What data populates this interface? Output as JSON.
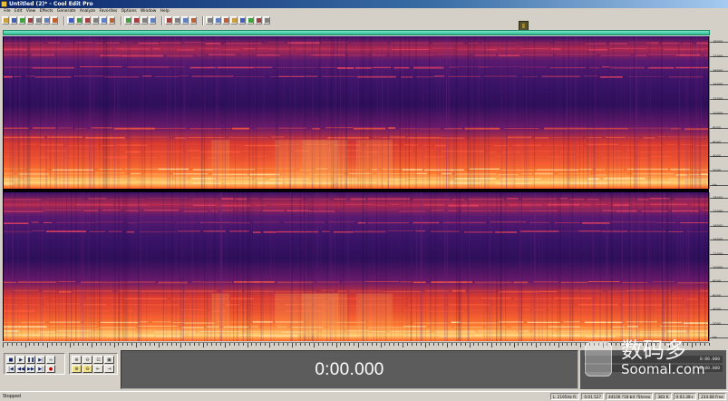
{
  "window": {
    "title": "Untitled (2)* - Cool Edit Pro"
  },
  "menu": [
    "File",
    "Edit",
    "View",
    "Effects",
    "Generate",
    "Analyze",
    "Favorites",
    "Options",
    "Window",
    "Help"
  ],
  "toolbar": {
    "groups": [
      [
        "open-icon",
        "folder-icon",
        "save-icon",
        "new-icon",
        "record-file-icon",
        "undo-icon",
        "repeat-icon"
      ],
      [
        "cut-icon",
        "copy-icon",
        "paste-icon",
        "paste-new-icon",
        "mix-paste-icon",
        "trim-icon"
      ],
      [
        "waveform-icon",
        "spectral-icon",
        "spectral-pan-icon",
        "spectral-phase-icon"
      ],
      [
        "cue-list-icon",
        "play-list-icon",
        "info-icon",
        "settings-icon"
      ],
      [
        "loop-icon",
        "bounce-icon",
        "stereo-icon",
        "mono-icon",
        "fx-icon",
        "meter-icon",
        "hardware-icon",
        "script-icon"
      ]
    ]
  },
  "frequency_ruler": {
    "labels": [
      "18000",
      "17000",
      "16000",
      "14000",
      "12000",
      "10000",
      "8000",
      "6000",
      "4000",
      "2000",
      "Hz"
    ]
  },
  "transport": {
    "buttons": [
      {
        "name": "stop-button",
        "glyph": "■"
      },
      {
        "name": "play-button",
        "glyph": "▶"
      },
      {
        "name": "pause-button",
        "glyph": "❚❚"
      },
      {
        "name": "play-to-end-button",
        "glyph": "▶|"
      },
      {
        "name": "loop-button",
        "glyph": "∞"
      },
      {
        "name": "goto-start-button",
        "glyph": "|◀"
      },
      {
        "name": "rewind-button",
        "glyph": "◀◀"
      },
      {
        "name": "fast-forward-button",
        "glyph": "▶▶"
      },
      {
        "name": "goto-end-button",
        "glyph": "▶|"
      },
      {
        "name": "record-button",
        "glyph": "●"
      }
    ]
  },
  "zoom": {
    "buttons": [
      {
        "name": "zoom-in-horizontal-button",
        "glyph": "⊕"
      },
      {
        "name": "zoom-out-horizontal-button",
        "glyph": "⊖"
      },
      {
        "name": "zoom-full-button",
        "glyph": "⊡"
      },
      {
        "name": "zoom-selection-button",
        "glyph": "▣"
      },
      {
        "name": "zoom-in-vertical-button",
        "glyph": "⊕"
      },
      {
        "name": "zoom-out-vertical-button",
        "glyph": "⊖"
      },
      {
        "name": "zoom-left-button",
        "glyph": "⇤"
      },
      {
        "name": "zoom-right-button",
        "glyph": "⇥"
      }
    ]
  },
  "time_display": {
    "value": "0:00.000"
  },
  "selection_panel": {
    "row1": "0:00.000",
    "row2": "0:00.000"
  },
  "watermark": {
    "cn": "数码多",
    "en": "Soomal.com"
  },
  "statusbar": {
    "left": "Stopped",
    "cells": [
      "L: 2195Hz R:",
      "0:01.527",
      "44100 ?16-bit ?Stereo",
      "383 K",
      "0:03.38+",
      "234.68 Free"
    ]
  },
  "colors": {
    "spectrum_low": "#2b1055",
    "spectrum_mid": "#a02060",
    "spectrum_high": "#ff4020",
    "spectrum_peak": "#ffe8a0",
    "overview_bar": "#3dcfa8"
  }
}
